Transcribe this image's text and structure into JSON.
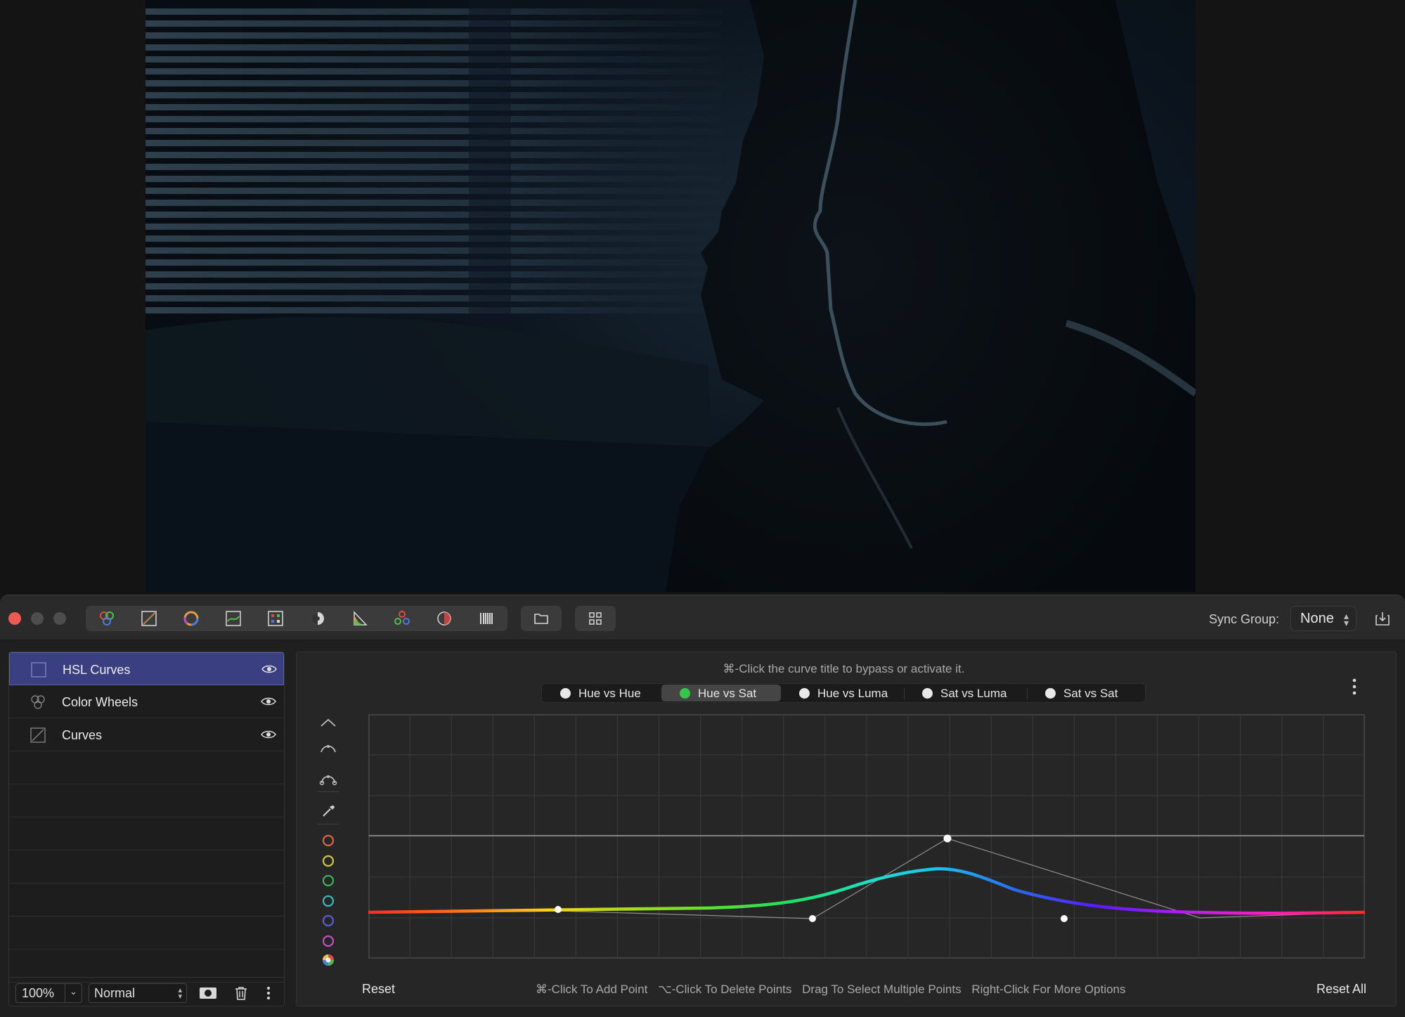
{
  "viewer": {
    "image_description_icon": "portrait-photo"
  },
  "titlebar": {
    "tools": [
      "color-wheels-icon",
      "curves-icon",
      "color-picker-icon",
      "luma-curve-icon",
      "lut-icon",
      "exposure-icon",
      "hsl-icon",
      "color-channels-icon",
      "vignette-icon",
      "film-grain-icon"
    ],
    "sync_label": "Sync Group:",
    "sync_value": "None"
  },
  "layers": {
    "items": [
      {
        "name": "HSL Curves",
        "icon": "hsl-curves-icon",
        "selected": true
      },
      {
        "name": "Color Wheels",
        "icon": "color-wheels-icon",
        "selected": false
      },
      {
        "name": "Curves",
        "icon": "curves-icon",
        "selected": false
      }
    ],
    "zoom": "100%",
    "blend_mode": "Normal"
  },
  "curves": {
    "hint": "⌘-Click the curve title to bypass or activate it.",
    "tabs": [
      {
        "label": "Hue vs Hue",
        "active": false
      },
      {
        "label": "Hue vs Sat",
        "active": true
      },
      {
        "label": "Hue vs Luma",
        "active": false
      },
      {
        "label": "Sat vs Luma",
        "active": false
      },
      {
        "label": "Sat vs Sat",
        "active": false
      }
    ],
    "swatches": [
      "#d9654a",
      "#c9c84a",
      "#3cb35a",
      "#3fb6bd",
      "#5c5fcf",
      "#c04fc4"
    ],
    "reset": "Reset",
    "reset_all": "Reset All",
    "instructions": [
      "⌘-Click To Add Point",
      "⌥-Click To Delete Points",
      "Drag To Select Multiple Points",
      "Right-Click For More Options"
    ]
  },
  "accent": {
    "selection": "#3a3f82",
    "active_dot": "#36c64a",
    "close": "#ee5a52"
  }
}
